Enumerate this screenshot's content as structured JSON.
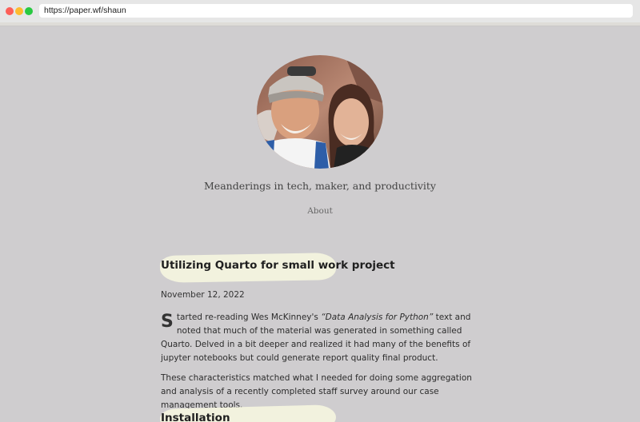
{
  "browser": {
    "url": "https://paper.wf/shaun"
  },
  "header": {
    "tagline": "Meanderings in tech, maker, and productivity",
    "nav": {
      "about": "About"
    }
  },
  "post": {
    "title": "Utilizing Quarto for small work project",
    "date": "November 12, 2022",
    "p1": {
      "dropcap": "S",
      "before": "tarted re-reading  Wes McKinney's ",
      "book": "“Data Analysis for Python”",
      "after": " text and noted that much of the material was generated in something called Quarto.  Delved in a bit deeper and realized it had many of the benefits of jupyter notebooks but could generate report quality final product."
    },
    "p2": "These characteristics matched what I needed for doing some aggregation and analysis of a recently completed staff survey around our case management tools.",
    "section": "Installation"
  },
  "colors": {
    "page_bg": "#cfcdcf",
    "highlight": "#f2f2de"
  }
}
